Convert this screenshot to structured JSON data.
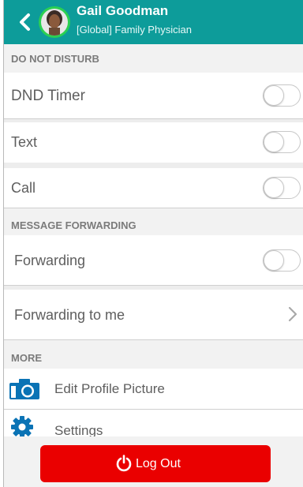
{
  "header": {
    "name": "Gail Goodman",
    "role": "[Global] Family Physician",
    "colors": {
      "bar": "#0d9c9a",
      "avatar_ring": "#2bd052"
    },
    "icons": {
      "back": "chevron-left-icon",
      "avatar": "avatar-photo"
    }
  },
  "dnd": {
    "section_label": "DO NOT DISTURB",
    "items": [
      {
        "label": "DND Timer",
        "toggle_on": false
      },
      {
        "label": "Text",
        "toggle_on": false
      },
      {
        "label": "Call",
        "toggle_on": false
      }
    ]
  },
  "forwarding": {
    "section_label": "MESSAGE FORWARDING",
    "items": [
      {
        "label": "Forwarding",
        "toggle_on": false
      },
      {
        "label": "Forwarding to me",
        "icon": "chevron-right-icon"
      }
    ]
  },
  "more": {
    "section_label": "MORE",
    "items": [
      {
        "label": "Edit Profile Picture",
        "icon": "camera-icon"
      },
      {
        "label": "Settings",
        "icon": "gear-icon"
      }
    ]
  },
  "footer": {
    "logout_label": "Log Out",
    "logout_icon": "power-icon",
    "color": "#ea0000"
  }
}
